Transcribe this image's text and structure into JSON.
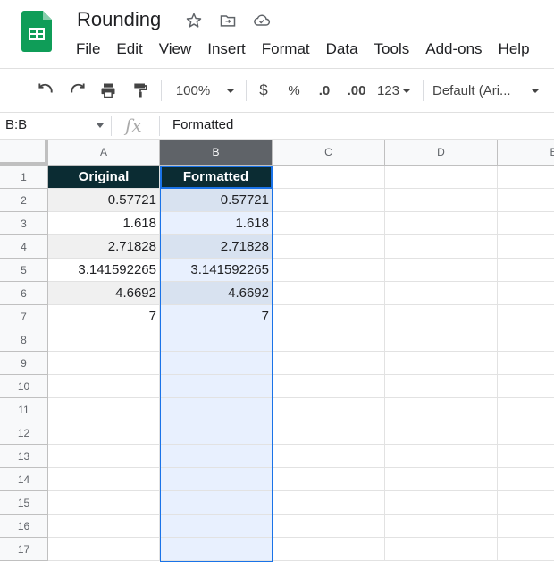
{
  "doc": {
    "title": "Rounding"
  },
  "menu": [
    "File",
    "Edit",
    "View",
    "Insert",
    "Format",
    "Data",
    "Tools",
    "Add-ons",
    "Help"
  ],
  "toolbar": {
    "zoom": "100%",
    "currency": "$",
    "percent": "%",
    "dec_decrease": ".0",
    "dec_increase": ".00",
    "more_formats": "123",
    "font": "Default (Ari..."
  },
  "formula_bar": {
    "name_box": "B:B",
    "fx": "fx",
    "value": "Formatted"
  },
  "columns": [
    "A",
    "B",
    "C",
    "D",
    "E"
  ],
  "rows": [
    "1",
    "2",
    "3",
    "4",
    "5",
    "6",
    "7",
    "8",
    "9",
    "10",
    "11",
    "12",
    "13",
    "14",
    "15",
    "16",
    "17"
  ],
  "cells": {
    "A1": "Original",
    "B1": "Formatted",
    "A2": "0.57721",
    "B2": "0.57721",
    "A3": "1.618",
    "B3": "1.618",
    "A4": "2.71828",
    "B4": "2.71828",
    "A5": "3.141592265",
    "B5": "3.141592265",
    "A6": "4.6692",
    "B6": "4.6692",
    "A7": "7",
    "B7": "7"
  },
  "colors": {
    "header_fill": "#0b2c33",
    "selection": "#1a73e8",
    "sheets_green": "#0f9d58"
  }
}
